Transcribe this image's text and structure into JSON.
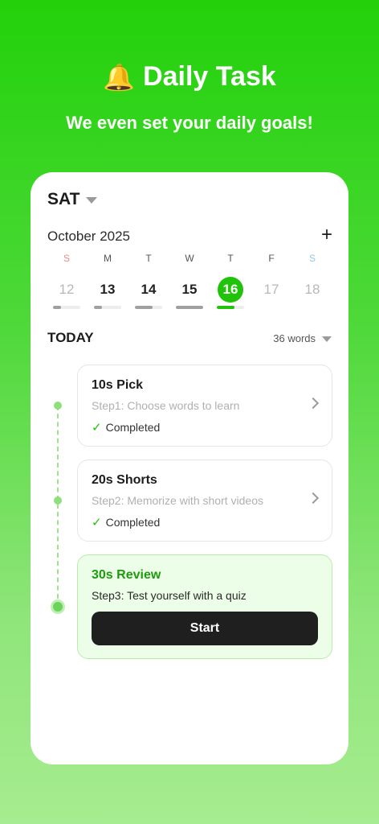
{
  "header": {
    "bell_icon": "🔔",
    "title": "Daily Task",
    "subtitle": "We even set your daily goals!"
  },
  "card": {
    "day": "SAT",
    "month": "October 2025",
    "add_icon": "+",
    "week": [
      {
        "weekday": "S",
        "date": "12",
        "state": "past-muted",
        "progress": 0.3
      },
      {
        "weekday": "M",
        "date": "13",
        "state": "done",
        "progress": 0.3
      },
      {
        "weekday": "T",
        "date": "14",
        "state": "done",
        "progress": 0.65
      },
      {
        "weekday": "W",
        "date": "15",
        "state": "done",
        "progress": 1.0
      },
      {
        "weekday": "T",
        "date": "16",
        "state": "selected",
        "progress": 0.65
      },
      {
        "weekday": "F",
        "date": "17",
        "state": "future",
        "progress": 0
      },
      {
        "weekday": "S",
        "date": "18",
        "state": "future",
        "progress": 0
      }
    ],
    "today_label": "TODAY",
    "word_count": "36 words",
    "steps": [
      {
        "title": "10s Pick",
        "desc": "Step1: Choose words to learn",
        "status": "Completed"
      },
      {
        "title": "20s Shorts",
        "desc": "Step2: Memorize with short videos",
        "status": "Completed"
      },
      {
        "title": "30s Review",
        "desc": "Step3: Test yourself with a quiz",
        "button": "Start"
      }
    ]
  },
  "colors": {
    "accent": "#21c20a",
    "dark_button": "#1f1f1f"
  }
}
